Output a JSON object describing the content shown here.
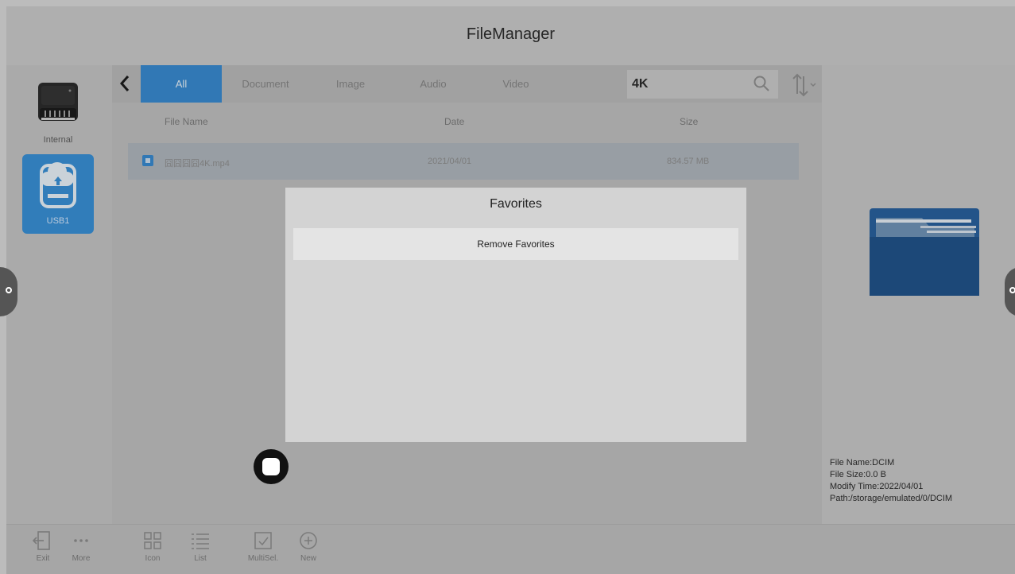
{
  "app": {
    "title": "FileManager"
  },
  "sidebar": {
    "drives": [
      {
        "label": "Internal",
        "selected": false
      },
      {
        "label": "USB1",
        "selected": true
      }
    ]
  },
  "tabs": {
    "items": [
      "All",
      "Document",
      "Image",
      "Audio",
      "Video"
    ],
    "active": "All"
  },
  "search": {
    "value": "4K"
  },
  "table": {
    "headers": {
      "name": "File Name",
      "date": "Date",
      "size": "Size"
    },
    "rows": [
      {
        "name": "囧囧囧囧4K.mp4",
        "date": "2021/04/01",
        "size": "834.57 MB",
        "checked": true
      }
    ]
  },
  "dialog": {
    "title": "Favorites",
    "options": [
      "Remove Favorites"
    ]
  },
  "details": {
    "file_name": "File Name:DCIM",
    "file_size": "File Size:0.0 B",
    "modify_time": "Modify Time:2022/04/01",
    "path": "Path:/storage/emulated/0/DCIM"
  },
  "toolbar": {
    "exit": "Exit",
    "more": "More",
    "icon": "Icon",
    "list": "List",
    "multisel": "MultiSel.",
    "new": "New"
  },
  "icons": {
    "back": "chevron-left-icon",
    "search": "search-icon",
    "sort": "sort-icon",
    "internal": "hard-drive-icon",
    "usb": "usb-drive-icon",
    "folder": "folder-icon"
  },
  "colors": {
    "accent": "#2f86d0",
    "folder": "#1e5a9a"
  }
}
